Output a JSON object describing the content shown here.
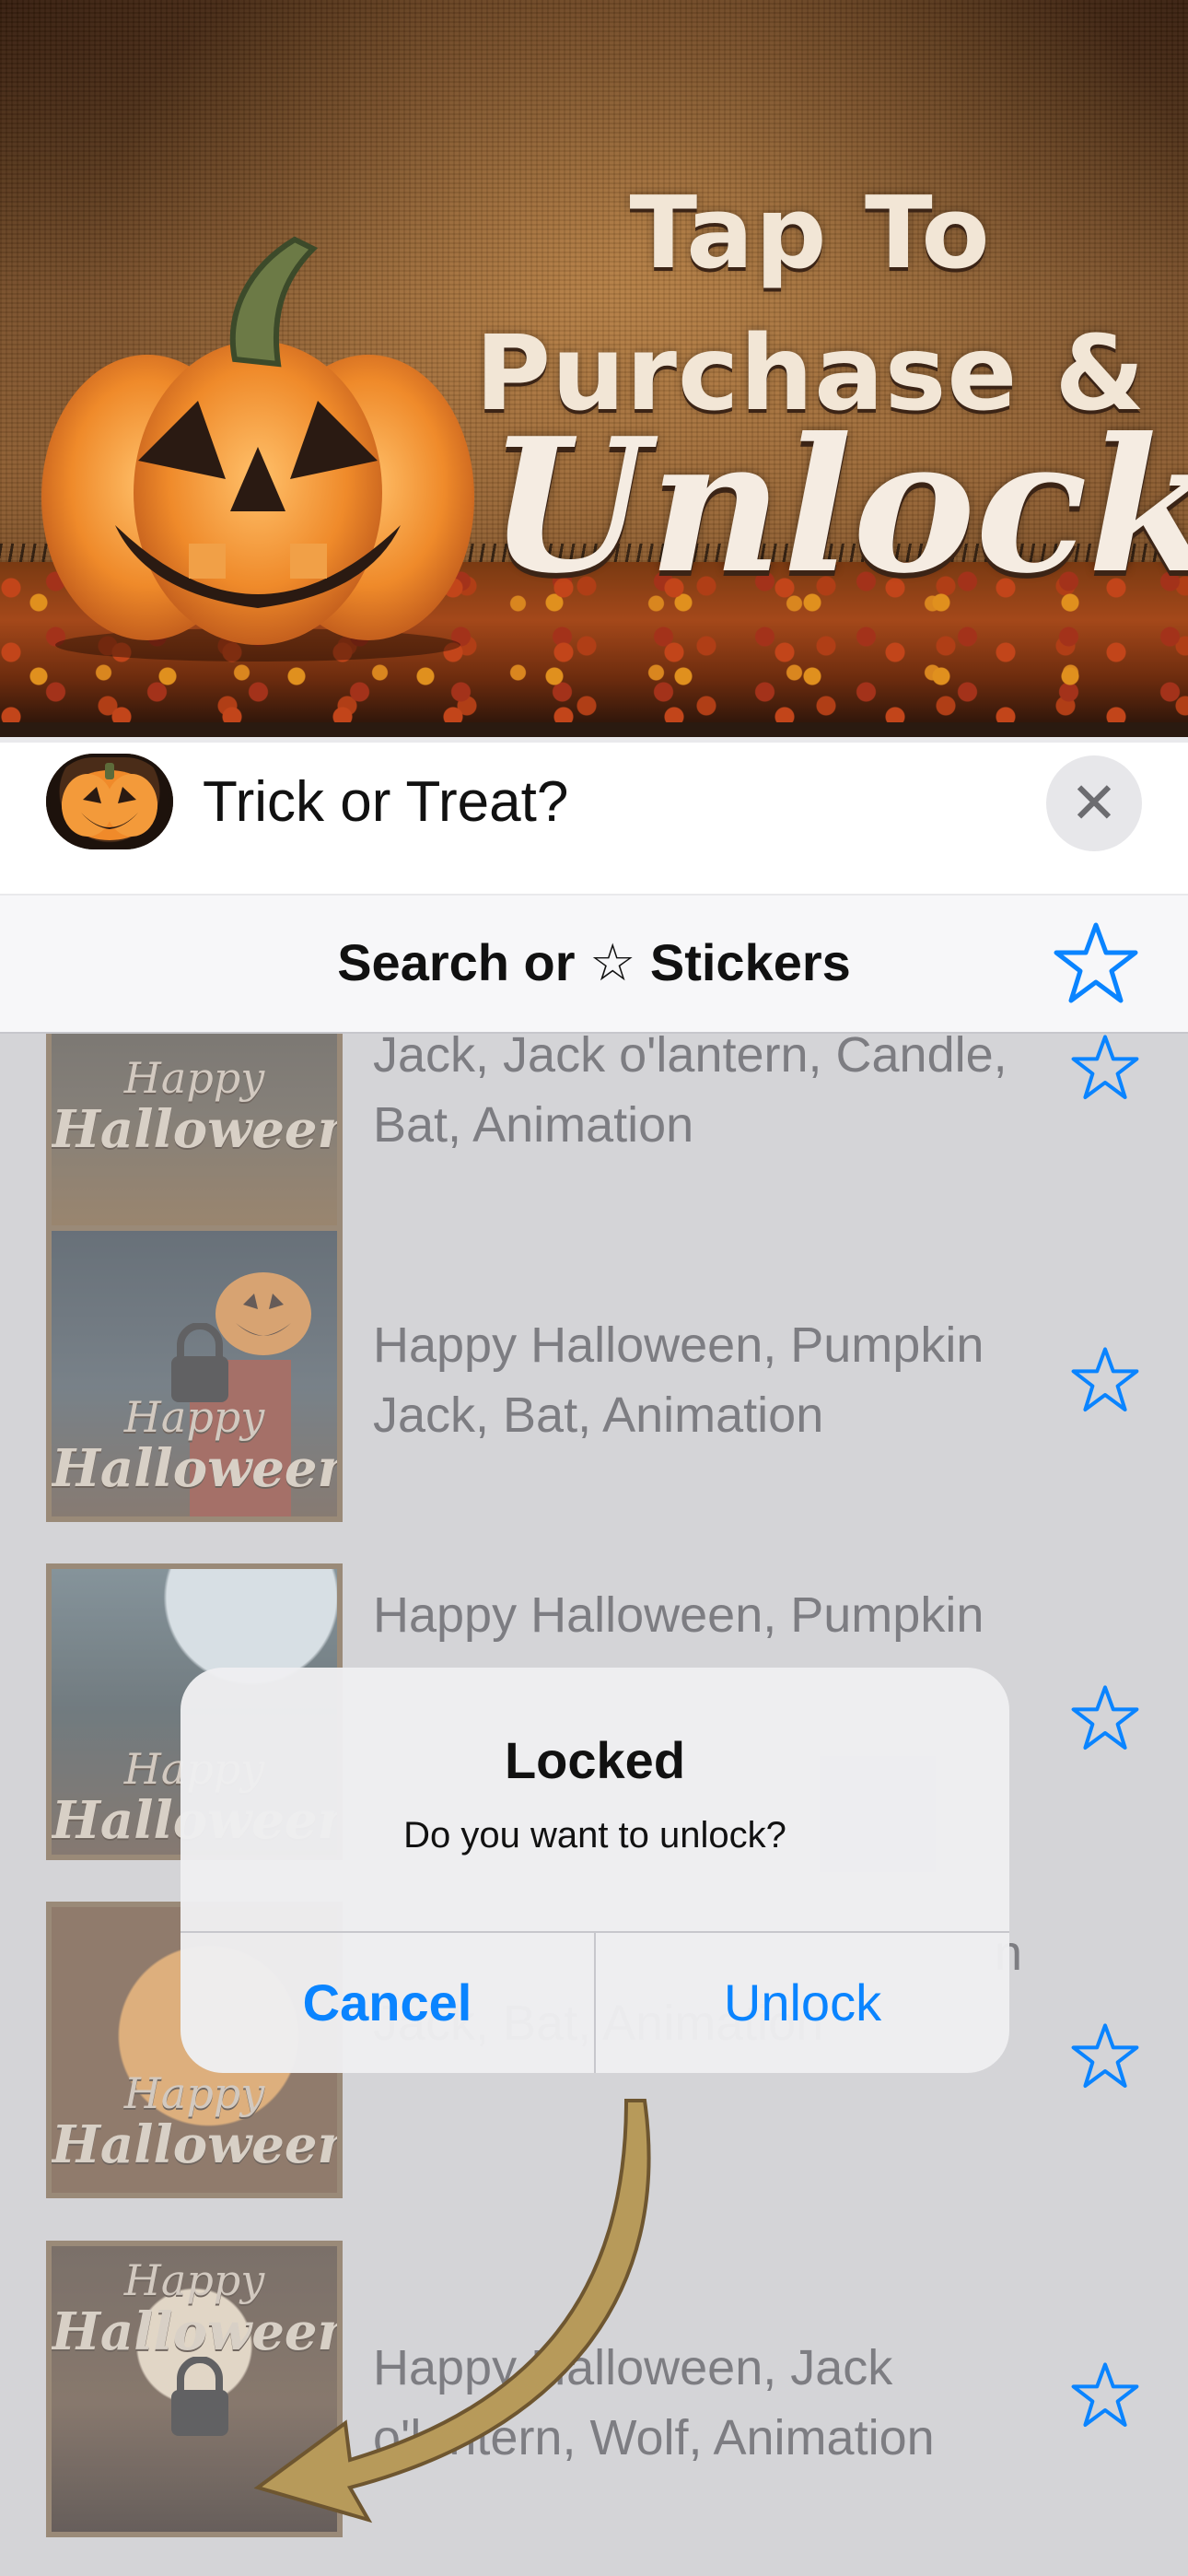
{
  "banner": {
    "line1": "Tap To",
    "line2": "Purchase &",
    "line3": "Unlock",
    "pumpkin_icon": "jack-o-lantern"
  },
  "header": {
    "title": "Trick or Treat?",
    "app_icon": "pumpkin-icon",
    "close_icon": "close-icon",
    "close_glyph": "✕"
  },
  "search": {
    "label": "Search or ☆  Stickers",
    "favorites_icon": "star-outline-icon"
  },
  "list": {
    "items": [
      {
        "thumb_top": "Happy",
        "thumb_bottom": "Halloween",
        "text": "Jack, Jack o'lantern, Candle,\nBat, Animation"
      },
      {
        "thumb_top": "Happy",
        "thumb_bottom": "Halloween",
        "text": "Happy Halloween, Pumpkin\nJack, Bat, Animation"
      },
      {
        "thumb_top": "Happy",
        "thumb_bottom": "Halloween",
        "text": "Happy Halloween, Pumpkin"
      },
      {
        "thumb_top": "Happy",
        "thumb_bottom": "Halloween",
        "text": "n\nJack, Bat, Animation"
      },
      {
        "thumb_top": "Happy",
        "thumb_bottom": "Halloween",
        "text": "Happy Halloween, Jack\no'lantern, Wolf, Animation"
      }
    ]
  },
  "dialog": {
    "title": "Locked",
    "message": "Do you want to unlock?",
    "cancel": "Cancel",
    "unlock": "Unlock"
  },
  "colors": {
    "accent": "#0a84ff",
    "list_text": "#7d7d82"
  }
}
